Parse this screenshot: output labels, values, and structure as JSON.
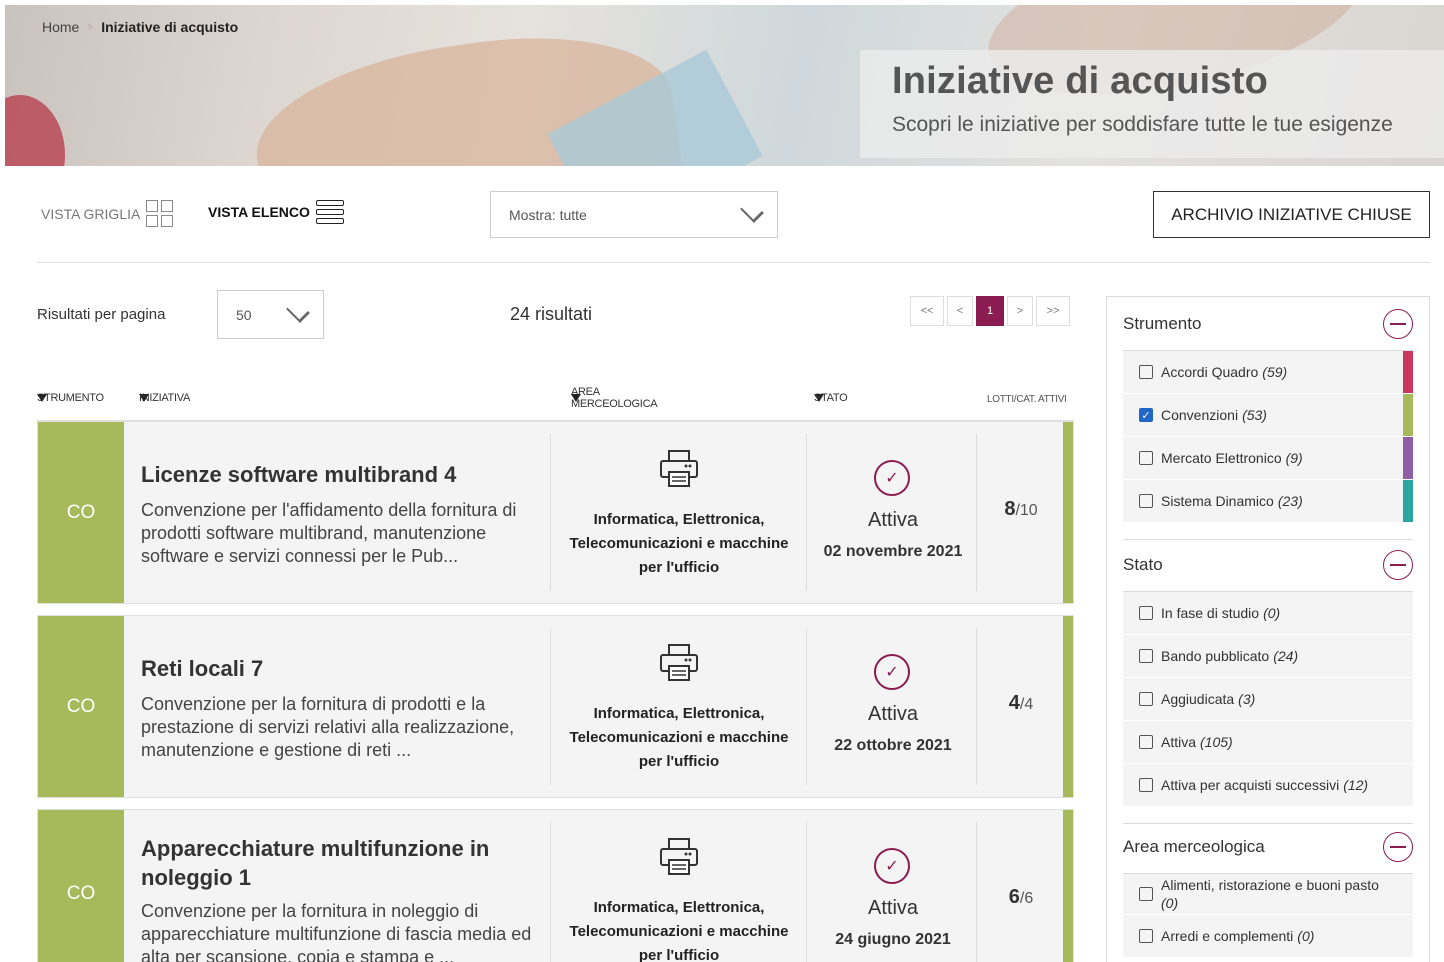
{
  "breadcrumb": {
    "home": "Home",
    "separator": ">",
    "current": "Iniziative di acquisto"
  },
  "hero": {
    "title": "Iniziative di acquisto",
    "subtitle": "Scopri le iniziative per soddisfare tutte le tue esigenze"
  },
  "toolbar": {
    "grid_view_label": "VISTA GRIGLIA",
    "list_view_label": "VISTA ELENCO",
    "show_select_value": "Mostra: tutte",
    "archive_button": "ARCHIVIO INIZIATIVE CHIUSE"
  },
  "results": {
    "per_page_label": "Risultati per pagina",
    "per_page_value": "50",
    "count_text": "24 risultati"
  },
  "pagination": {
    "first": "<<",
    "prev": "<",
    "current": "1",
    "next": ">",
    "last": ">>"
  },
  "table": {
    "headers": {
      "strumento": "STRUMENTO",
      "iniziativa": "INIZIATIVA",
      "area": "AREA MERCEOLOGICA",
      "stato": "STATO",
      "lotti": "LOTTI/CAT. ATTIVI"
    },
    "rows": [
      {
        "badge": "CO",
        "title": "Licenze software multibrand 4",
        "description": "Convenzione per l'affidamento della fornitura di prodotti software multibrand, manutenzione software e servizi connessi per le Pub...",
        "area": "Informatica, Elettronica, Telecomunicazioni e macchine per l'ufficio",
        "area_icon": "printer-icon",
        "status": "Attiva",
        "status_icon": "check-circle-icon",
        "date": "02 novembre 2021",
        "lotti_active": "8",
        "lotti_total": "/10"
      },
      {
        "badge": "CO",
        "title": "Reti locali 7",
        "description": "Convenzione per la fornitura di prodotti e la prestazione di servizi relativi alla realizzazione, manutenzione e gestione di reti ...",
        "area": "Informatica, Elettronica, Telecomunicazioni e macchine per l'ufficio",
        "area_icon": "printer-icon",
        "status": "Attiva",
        "status_icon": "check-circle-icon",
        "date": "22 ottobre 2021",
        "lotti_active": "4",
        "lotti_total": "/4"
      },
      {
        "badge": "CO",
        "title": "Apparecchiature multifunzione in noleggio 1",
        "description": "Convenzione per la fornitura in noleggio di apparecchiature multifunzione di fascia media ed alta per scansione, copia e stampa e ...",
        "area": "Informatica, Elettronica, Telecomunicazioni e macchine per l'ufficio",
        "area_icon": "printer-icon",
        "status": "Attiva",
        "status_icon": "check-circle-icon",
        "date": "24 giugno 2021",
        "lotti_active": "6",
        "lotti_total": "/6"
      }
    ]
  },
  "sidebar": {
    "strumento": {
      "title": "Strumento",
      "items": [
        {
          "label": "Accordi Quadro",
          "count": "(59)",
          "checked": false,
          "color": "#c8385e"
        },
        {
          "label": "Convenzioni",
          "count": "(53)",
          "checked": true,
          "color": "#a7b95a"
        },
        {
          "label": "Mercato Elettronico",
          "count": "(9)",
          "checked": false,
          "color": "#8f5fa6"
        },
        {
          "label": "Sistema Dinamico",
          "count": "(23)",
          "checked": false,
          "color": "#2aa5a0"
        }
      ]
    },
    "stato": {
      "title": "Stato",
      "items": [
        {
          "label": "In fase di studio",
          "count": "(0)"
        },
        {
          "label": "Bando pubblicato",
          "count": "(24)"
        },
        {
          "label": "Aggiudicata",
          "count": "(3)"
        },
        {
          "label": "Attiva",
          "count": "(105)"
        },
        {
          "label": "Attiva per acquisti successivi",
          "count": "(12)"
        }
      ]
    },
    "area": {
      "title": "Area merceologica",
      "items": [
        {
          "label": "Alimenti, ristorazione e buoni pasto",
          "count": "(0)"
        },
        {
          "label": "Arredi e complementi",
          "count": "(0)"
        }
      ]
    }
  },
  "colors": {
    "accent": "#8a1c52",
    "convenzioni": "#a7b95a",
    "checkbox": "#1f66c6"
  }
}
